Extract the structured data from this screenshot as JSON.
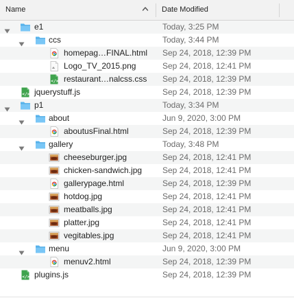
{
  "header": {
    "name_label": "Name",
    "date_label": "Date Modified"
  },
  "rows": [
    {
      "name": "e1",
      "date": "Today, 3:25 PM",
      "kind": "folder",
      "level": 0,
      "expanded": true
    },
    {
      "name": "ccs",
      "date": "Today, 3:44 PM",
      "kind": "folder",
      "level": 1,
      "expanded": true
    },
    {
      "name": "homepag…FINAL.html",
      "date": "Sep 24, 2018, 12:39 PM",
      "kind": "html",
      "level": 2
    },
    {
      "name": "Logo_TV_2015.png",
      "date": "Sep 24, 2018, 12:41 PM",
      "kind": "png",
      "level": 2
    },
    {
      "name": "restaurant…nalcss.css",
      "date": "Sep 24, 2018, 12:39 PM",
      "kind": "code",
      "level": 2
    },
    {
      "name": "jquerystuff.js",
      "date": "Sep 24, 2018, 12:39 PM",
      "kind": "code",
      "level": 0
    },
    {
      "name": "p1",
      "date": "Today, 3:34 PM",
      "kind": "folder",
      "level": 0,
      "expanded": true
    },
    {
      "name": "about",
      "date": "Jun 9, 2020, 3:00 PM",
      "kind": "folder",
      "level": 1,
      "expanded": true
    },
    {
      "name": "aboutusFinal.html",
      "date": "Sep 24, 2018, 12:39 PM",
      "kind": "html",
      "level": 2
    },
    {
      "name": "gallery",
      "date": "Today, 3:48 PM",
      "kind": "folder",
      "level": 1,
      "expanded": true
    },
    {
      "name": "cheeseburger.jpg",
      "date": "Sep 24, 2018, 12:41 PM",
      "kind": "jpg",
      "level": 2
    },
    {
      "name": "chicken-sandwich.jpg",
      "date": "Sep 24, 2018, 12:41 PM",
      "kind": "jpg",
      "level": 2
    },
    {
      "name": "gallerypage.html",
      "date": "Sep 24, 2018, 12:39 PM",
      "kind": "html",
      "level": 2
    },
    {
      "name": "hotdog.jpg",
      "date": "Sep 24, 2018, 12:41 PM",
      "kind": "jpg",
      "level": 2
    },
    {
      "name": "meatballs.jpg",
      "date": "Sep 24, 2018, 12:41 PM",
      "kind": "jpg",
      "level": 2
    },
    {
      "name": "platter.jpg",
      "date": "Sep 24, 2018, 12:41 PM",
      "kind": "jpg",
      "level": 2
    },
    {
      "name": "vegitables.jpg",
      "date": "Sep 24, 2018, 12:41 PM",
      "kind": "jpg",
      "level": 2
    },
    {
      "name": "menu",
      "date": "Jun 9, 2020, 3:00 PM",
      "kind": "folder",
      "level": 1,
      "expanded": true
    },
    {
      "name": "menuv2.html",
      "date": "Sep 24, 2018, 12:39 PM",
      "kind": "html",
      "level": 2
    },
    {
      "name": "plugins.js",
      "date": "Sep 24, 2018, 12:39 PM",
      "kind": "code",
      "level": 0
    }
  ],
  "colors": {
    "folder": "#5ab6ef",
    "code": "#4caf50",
    "date_text": "#6b6b6b",
    "alt_row": "#f4f5f5"
  },
  "icons": {
    "folder": "folder-icon",
    "html": "chrome-html-file-icon",
    "png": "png-image-file-icon",
    "jpg": "jpg-image-file-icon",
    "code": "code-file-icon",
    "disclosure": "disclosure-triangle-icon",
    "sort": "sort-ascending-icon"
  }
}
